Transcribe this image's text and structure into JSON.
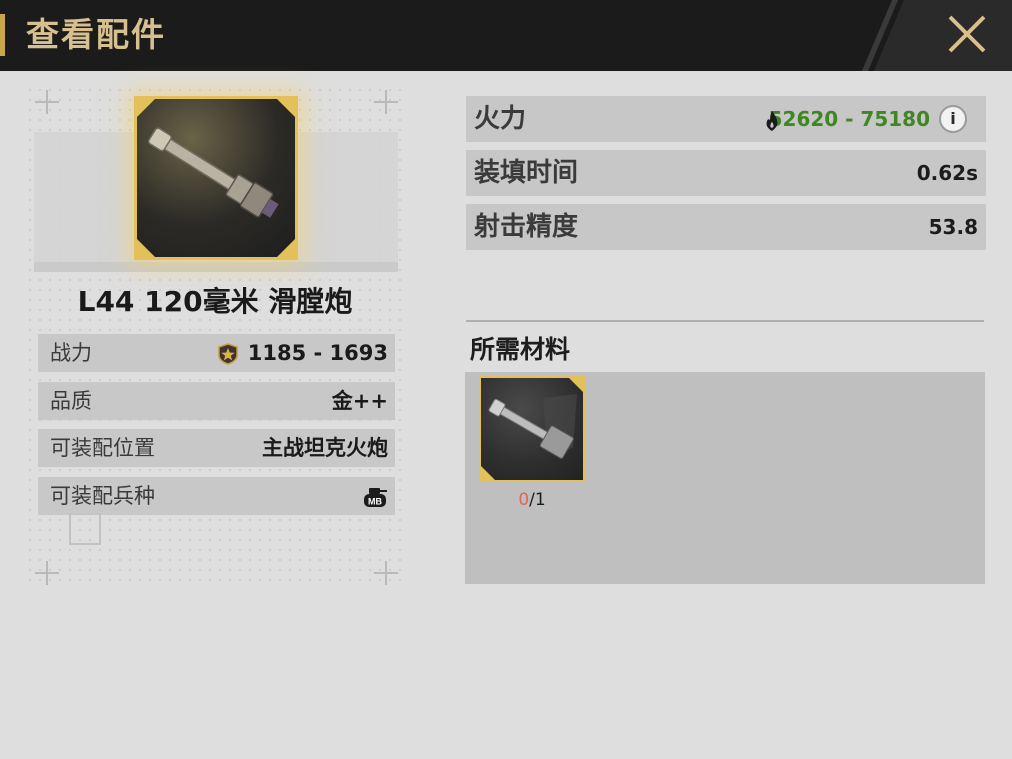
{
  "header": {
    "title": "查看配件"
  },
  "item": {
    "name": "L44 120毫米 滑膛炮"
  },
  "stats": [
    {
      "label": "战力",
      "value": "1185 - 1693",
      "icon": "star-shield-icon"
    },
    {
      "label": "品质",
      "value": "金++"
    },
    {
      "label": "可装配位置",
      "value": "主战坦克火炮"
    },
    {
      "label": "可装配兵种",
      "value": "",
      "icon": "mbt-tank-icon",
      "icon_text": "MB"
    }
  ],
  "attributes": [
    {
      "label": "火力",
      "value": "52620 - 75180",
      "icon": "fire-icon",
      "color": "#3f8722"
    },
    {
      "label": "装填时间",
      "value": "0.62s"
    },
    {
      "label": "射击精度",
      "value": "53.8"
    }
  ],
  "materials": {
    "title": "所需材料",
    "items": [
      {
        "have": "0",
        "need": "/1"
      }
    ]
  },
  "colors": {
    "header_bg": "#1b1b1b",
    "header_text": "#d7c08f",
    "gold": "#e3c05a",
    "fire_green": "#3f8722"
  }
}
